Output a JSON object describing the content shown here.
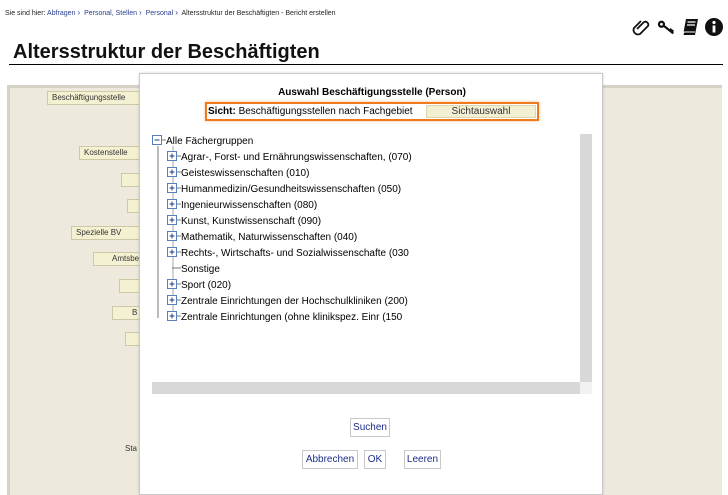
{
  "breadcrumb": {
    "prefix": "Sie sind hier:",
    "items": [
      "Abfragen",
      "Personal, Stellen",
      "Personal"
    ],
    "current": "Altersstruktur der Beschäftigten - Bericht erstellen"
  },
  "toolbar": {
    "icons": [
      "attachment-icon",
      "keys-icon",
      "book-icon",
      "info-icon"
    ]
  },
  "page": {
    "title": "Altersstruktur der Beschäftigten"
  },
  "background_form": {
    "labels": [
      "Beschäftigungsstelle",
      "Kostenstelle",
      "",
      "",
      "Spezielle BV",
      "Amtsbez",
      "",
      "B",
      "",
      "Sta"
    ]
  },
  "dialog": {
    "title": "Auswahl Beschäftigungsstelle (Person)",
    "sicht_label": "Sicht:",
    "sicht_value": "Beschäftigungsstellen nach Fachgebiet",
    "sicht_button": "Sichtauswahl",
    "tree": {
      "root": "Alle Fächergruppen",
      "children": [
        "Agrar-, Forst- und Ernährungswissenschaften, (070)",
        "Geisteswissenschaften (010)",
        "Humanmedizin/Gesundheitswissenschaften (050)",
        "Ingenieurwissenschaften (080)",
        "Kunst, Kunstwissenschaft (090)",
        "Mathematik, Naturwissenschaften (040)",
        "Rechts-, Wirtschafts- und Sozialwissenschafte (030",
        "Sonstige",
        "Sport (020)",
        "Zentrale Einrichtungen der Hochschulkliniken (200)",
        "Zentrale Einrichtungen (ohne klinikspez. Einr (150"
      ],
      "expandable": [
        true,
        true,
        true,
        true,
        true,
        true,
        true,
        false,
        true,
        true,
        true
      ]
    },
    "buttons": {
      "search": "Suchen",
      "cancel": "Abbrechen",
      "ok": "OK",
      "clear": "Leeren"
    }
  },
  "colors": {
    "highlight": "#f07a1e",
    "link": "#2a3f8f",
    "button_text": "#1c2f8a",
    "panel": "#ede9dd"
  }
}
